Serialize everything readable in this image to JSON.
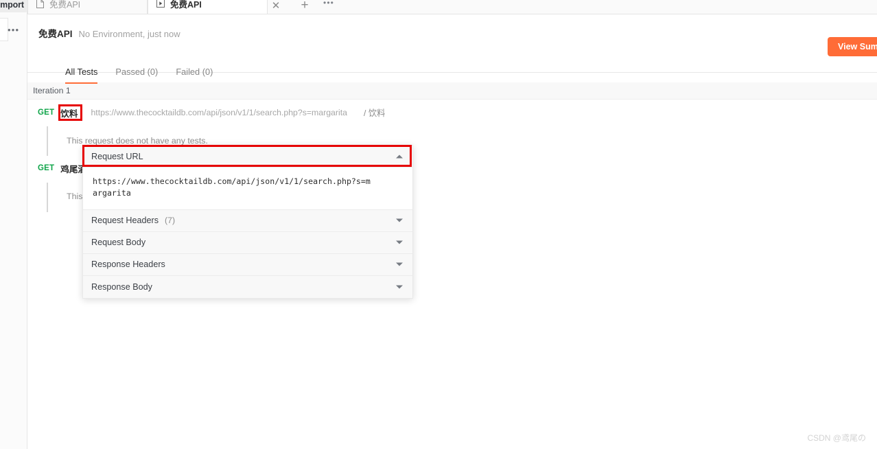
{
  "left_rail": {
    "import_label": "Import",
    "more_icon": "more-horizontal-icon"
  },
  "tabs": {
    "items": [
      {
        "label": "免费API",
        "icon": "document-icon",
        "active": false
      },
      {
        "label": "免费API",
        "icon": "runner-play-icon",
        "active": true
      }
    ],
    "close_label": "✕",
    "new_tab_label": "+",
    "more_label": "•••"
  },
  "run_header": {
    "title": "免费API",
    "subtitle": "No Environment, just now",
    "view_summary_label": "View Summary"
  },
  "filter_tabs": [
    {
      "label": "All Tests",
      "selected": true
    },
    {
      "label": "Passed (0)",
      "selected": false
    },
    {
      "label": "Failed (0)",
      "selected": false
    }
  ],
  "iteration": {
    "label": "Iteration 1"
  },
  "requests": [
    {
      "method": "GET",
      "name": "饮料",
      "url": "https://www.thecocktaildb.com/api/json/v1/1/search.php?s=margarita",
      "folder": "/ 饮料",
      "no_tests": "This request does not have any tests."
    },
    {
      "method": "GET",
      "name": "鸡尾酒",
      "no_tests": "This request does not have any tests."
    }
  ],
  "popover": {
    "sections": [
      {
        "title": "Request URL",
        "count": "",
        "expanded": true,
        "body": "https://www.thecocktaildb.com/api/json/v1/1/search.php?s=margarita"
      },
      {
        "title": "Request Headers",
        "count": "(7)",
        "expanded": false
      },
      {
        "title": "Request Body",
        "count": "",
        "expanded": false
      },
      {
        "title": "Response Headers",
        "count": "",
        "expanded": false
      },
      {
        "title": "Response Body",
        "count": "",
        "expanded": false
      }
    ]
  },
  "watermark": "CSDN @鸢尾の",
  "colors": {
    "accent": "#ff6c37",
    "method_get": "#10a54a",
    "annotation": "#e60000"
  }
}
